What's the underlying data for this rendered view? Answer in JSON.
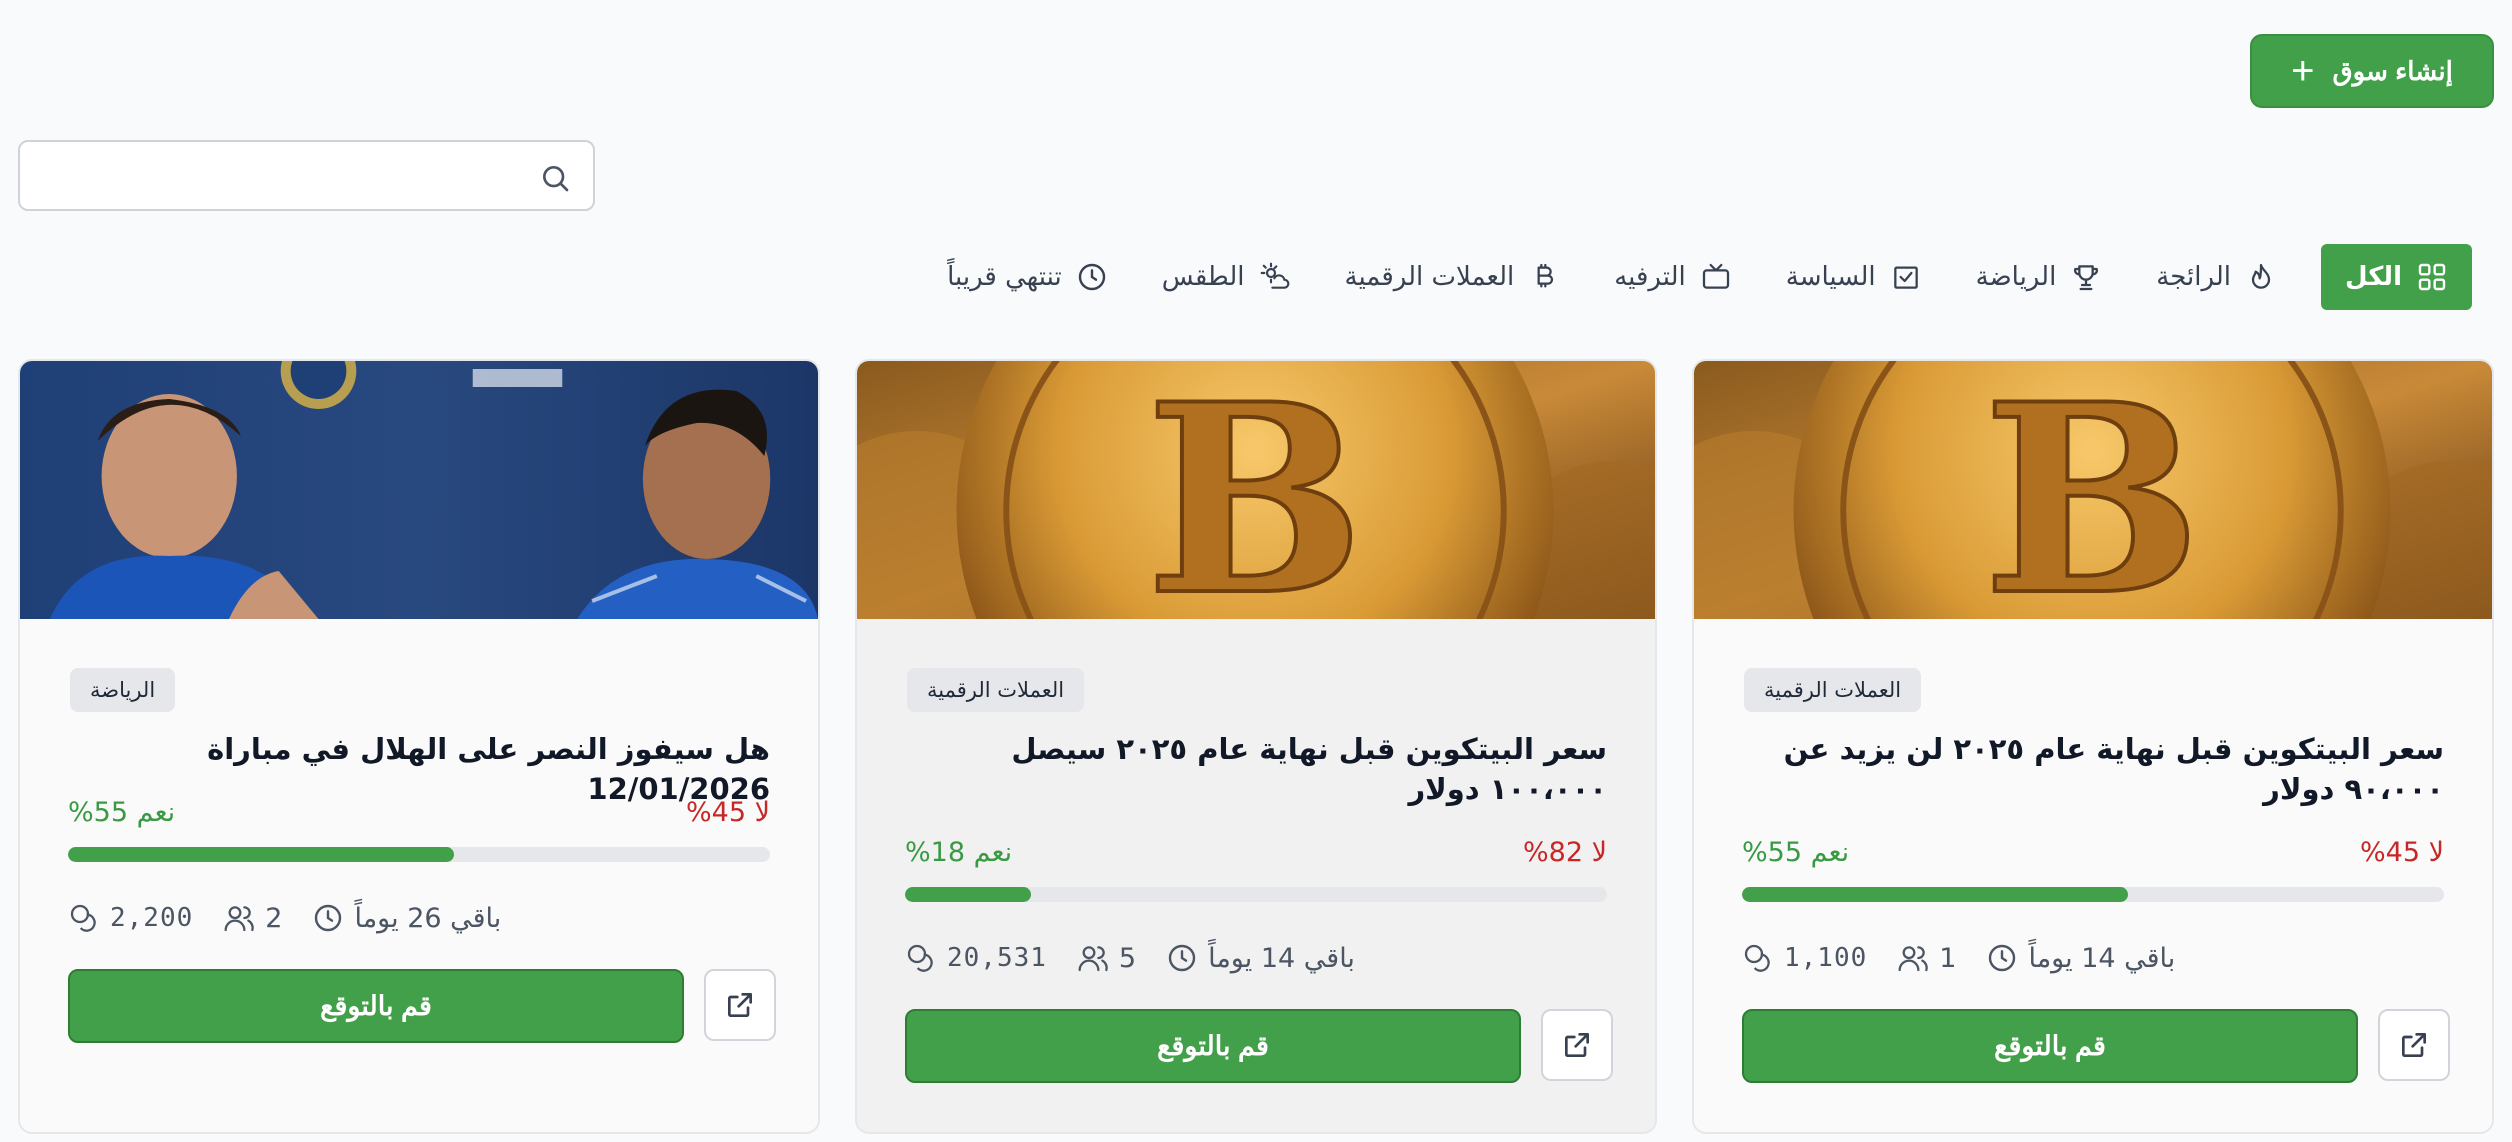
{
  "header": {
    "create_button": "إنشاء سوق"
  },
  "search": {
    "placeholder": ""
  },
  "filters": [
    {
      "label": "تنتهي قريباً",
      "icon": "clock-icon"
    },
    {
      "label": "الطقس",
      "icon": "weather-icon"
    },
    {
      "label": "العملات الرقمية",
      "icon": "bitcoin-icon"
    },
    {
      "label": "الترفيه",
      "icon": "tv-icon"
    },
    {
      "label": "السياسة",
      "icon": "ballot-icon"
    },
    {
      "label": "الرياضة",
      "icon": "trophy-icon"
    },
    {
      "label": "الرائجة",
      "icon": "flame-icon"
    },
    {
      "label": "الكل",
      "icon": "grid-icon",
      "active": true
    }
  ],
  "colors": {
    "accent": "#43a04a",
    "yes": "#3a9a44",
    "no": "#c62828"
  },
  "cards": [
    {
      "category": "الرياضة",
      "title": "هل سيفوز النصر على الهلال في مباراة 12/01/2026",
      "yes_label": "نعم 55%",
      "no_label": "لا 45%",
      "yes_pct": 55,
      "volume": "2,200",
      "participants": "2",
      "time_left": "باقي 26 يوماً",
      "predict_button": "قم بالتوقع"
    },
    {
      "category": "العملات الرقمية",
      "title": "سعر البيتكوين قبل نهاية عام ٢٠٢٥ سيصل ١٠٠،٠٠٠ دولار",
      "yes_label": "نعم 18%",
      "no_label": "لا 82%",
      "yes_pct": 18,
      "volume": "20,531",
      "participants": "5",
      "time_left": "باقي 14 يوماً",
      "predict_button": "قم بالتوقع"
    },
    {
      "category": "العملات الرقمية",
      "title": "سعر البيتكوين قبل نهاية عام ٢٠٢٥ لن يزيد عن ٩٠،٠٠٠ دولار",
      "yes_label": "نعم 55%",
      "no_label": "لا 45%",
      "yes_pct": 55,
      "volume": "1,100",
      "participants": "1",
      "time_left": "باقي 14 يوماً",
      "predict_button": "قم بالتوقع"
    }
  ]
}
